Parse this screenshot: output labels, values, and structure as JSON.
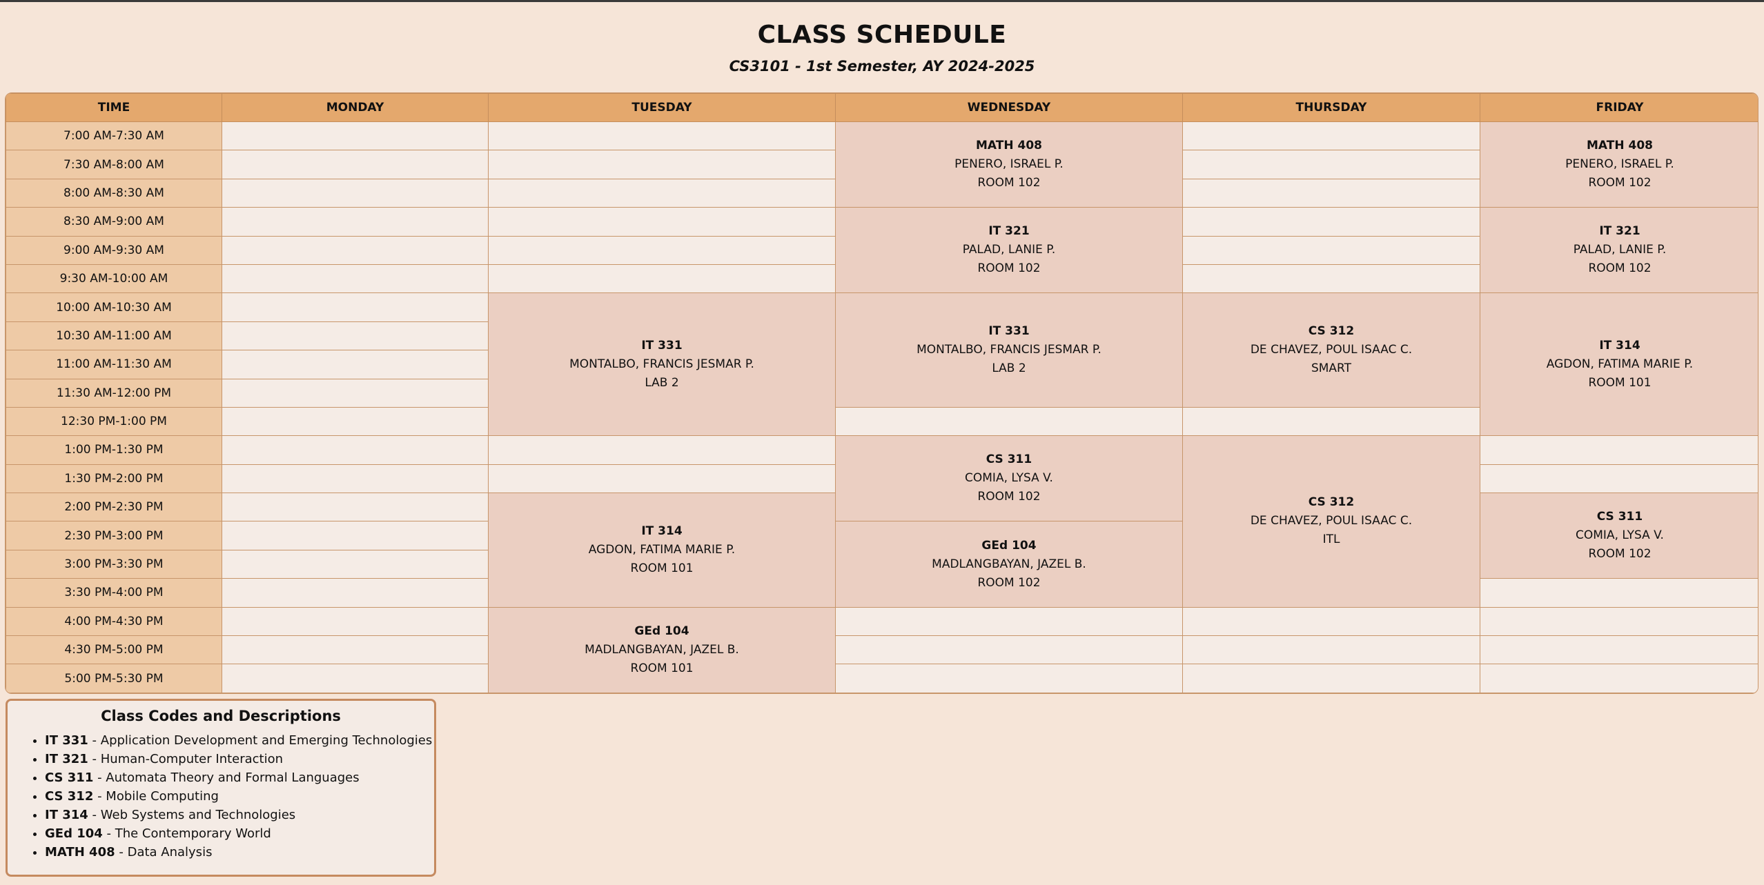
{
  "title": "CLASS SCHEDULE",
  "subtitle": "CS3101 - 1st Semester, AY 2024-2025",
  "headers": [
    "TIME",
    "MONDAY",
    "TUESDAY",
    "WEDNESDAY",
    "THURSDAY",
    "FRIDAY"
  ],
  "times": [
    "7:00 AM-7:30 AM",
    "7:30 AM-8:00 AM",
    "8:00 AM-8:30 AM",
    "8:30 AM-9:00 AM",
    "9:00 AM-9:30 AM",
    "9:30 AM-10:00 AM",
    "10:00 AM-10:30 AM",
    "10:30 AM-11:00 AM",
    "11:00 AM-11:30 AM",
    "11:30 AM-12:00 PM",
    "12:30 PM-1:00 PM",
    "1:00 PM-1:30 PM",
    "1:30 PM-2:00 PM",
    "2:00 PM-2:30 PM",
    "2:30 PM-3:00 PM",
    "3:00 PM-3:30 PM",
    "3:30 PM-4:00 PM",
    "4:00 PM-4:30 PM",
    "4:30 PM-5:00 PM",
    "5:00 PM-5:30 PM"
  ],
  "classes": [
    {
      "day": 2,
      "start": 0,
      "rows": 3,
      "code": "MATH 408",
      "instructor": "PENERO, ISRAEL P.",
      "room": "ROOM 102"
    },
    {
      "day": 4,
      "start": 0,
      "rows": 3,
      "code": "MATH 408",
      "instructor": "PENERO, ISRAEL P.",
      "room": "ROOM 102"
    },
    {
      "day": 2,
      "start": 3,
      "rows": 3,
      "code": "IT 321",
      "instructor": "PALAD, LANIE P.",
      "room": "ROOM 102"
    },
    {
      "day": 4,
      "start": 3,
      "rows": 3,
      "code": "IT 321",
      "instructor": "PALAD, LANIE P.",
      "room": "ROOM 102"
    },
    {
      "day": 1,
      "start": 6,
      "rows": 5,
      "code": "IT 331",
      "instructor": "MONTALBO, FRANCIS JESMAR P.",
      "room": "LAB 2"
    },
    {
      "day": 2,
      "start": 6,
      "rows": 4,
      "code": "IT 331",
      "instructor": "MONTALBO, FRANCIS JESMAR P.",
      "room": "LAB 2"
    },
    {
      "day": 3,
      "start": 6,
      "rows": 4,
      "code": "CS 312",
      "instructor": "DE CHAVEZ, POUL ISAAC C.",
      "room": "SMART"
    },
    {
      "day": 4,
      "start": 6,
      "rows": 5,
      "code": "IT 314",
      "instructor": "AGDON, FATIMA MARIE P.",
      "room": "ROOM 101"
    },
    {
      "day": 2,
      "start": 11,
      "rows": 3,
      "code": "CS 311",
      "instructor": "COMIA, LYSA V.",
      "room": "ROOM 102"
    },
    {
      "day": 3,
      "start": 11,
      "rows": 6,
      "code": "CS 312",
      "instructor": "DE CHAVEZ, POUL ISAAC C.",
      "room": "ITL"
    },
    {
      "day": 1,
      "start": 13,
      "rows": 4,
      "code": "IT 314",
      "instructor": "AGDON, FATIMA MARIE P.",
      "room": "ROOM 101"
    },
    {
      "day": 4,
      "start": 13,
      "rows": 3,
      "code": "CS 311",
      "instructor": "COMIA, LYSA V.",
      "room": "ROOM 102"
    },
    {
      "day": 2,
      "start": 14,
      "rows": 3,
      "code": "GEd 104",
      "instructor": "MADLANGBAYAN, JAZEL B.",
      "room": "ROOM 102"
    },
    {
      "day": 1,
      "start": 17,
      "rows": 3,
      "code": "GEd 104",
      "instructor": "MADLANGBAYAN, JAZEL B.",
      "room": "ROOM 101"
    }
  ],
  "legend": {
    "title": "Class Codes and Descriptions",
    "items": [
      {
        "code": "IT 331",
        "desc": " - Application Development and Emerging Technologies"
      },
      {
        "code": "IT 321",
        "desc": " - Human-Computer Interaction"
      },
      {
        "code": "CS 311",
        "desc": " - Automata Theory and Formal Languages"
      },
      {
        "code": "CS 312",
        "desc": " - Mobile Computing"
      },
      {
        "code": "IT 314",
        "desc": " - Web Systems and Technologies"
      },
      {
        "code": "GEd 104",
        "desc": " - The Contemporary World"
      },
      {
        "code": "MATH 408",
        "desc": " - Data Analysis"
      }
    ]
  },
  "colors": {
    "background": "#f6e5d8",
    "header": "#e4a86d",
    "time_cell": "#eecaa6",
    "class_cell": "#ebcfc2",
    "empty_cell": "#f5ece6",
    "border": "#c58a5f"
  }
}
